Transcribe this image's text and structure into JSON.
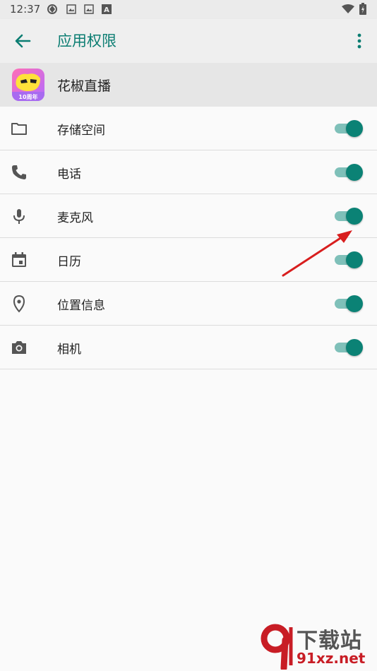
{
  "status_bar": {
    "time": "12:37",
    "icons": [
      "sync-icon",
      "gallery-icon",
      "gallery-icon",
      "a-icon",
      "wifi-icon",
      "battery-icon"
    ]
  },
  "toolbar": {
    "title": "应用权限",
    "back_icon": "arrow-left-icon",
    "more_icon": "more-vert-icon",
    "accent": "#0b7d72"
  },
  "app": {
    "name": "花椒直播",
    "icon_badge": "10周年"
  },
  "permissions": [
    {
      "label": "存储空间",
      "icon": "folder-icon",
      "enabled": true
    },
    {
      "label": "电话",
      "icon": "phone-icon",
      "enabled": true
    },
    {
      "label": "麦克风",
      "icon": "microphone-icon",
      "enabled": true
    },
    {
      "label": "日历",
      "icon": "calendar-icon",
      "enabled": true
    },
    {
      "label": "位置信息",
      "icon": "location-icon",
      "enabled": true
    },
    {
      "label": "相机",
      "icon": "camera-icon",
      "enabled": true
    }
  ],
  "watermark": {
    "big": "下载站",
    "url": "91xz.net"
  },
  "colors": {
    "toggle_on": "#0b8275",
    "toggle_track": "#7fc0b9",
    "annotation_arrow": "#d81e1e"
  }
}
